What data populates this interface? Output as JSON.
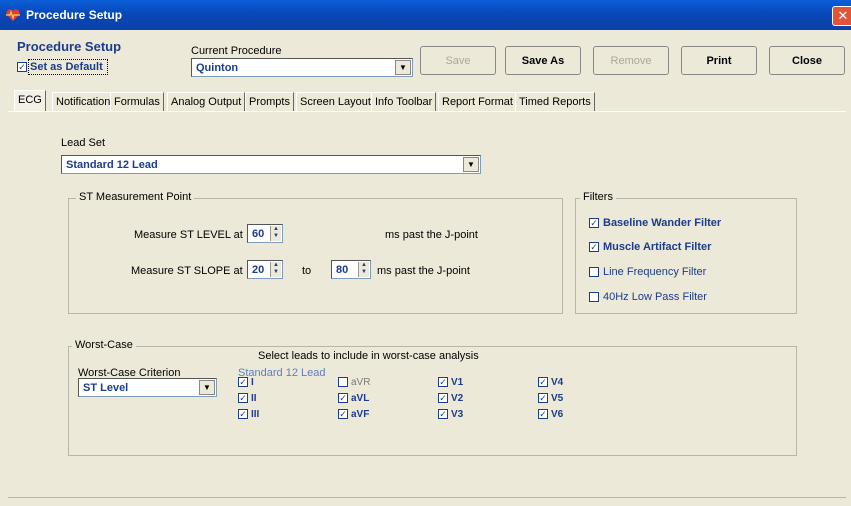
{
  "window": {
    "title": "Procedure Setup",
    "close_glyph": "✕"
  },
  "header": {
    "heading": "Procedure Setup",
    "set_as_default": {
      "label": "Set as Default",
      "checked": true
    },
    "current_procedure": {
      "label": "Current Procedure",
      "value": "Quinton"
    }
  },
  "toolbar": {
    "save": "Save",
    "save_as": "Save As",
    "remove": "Remove",
    "print": "Print",
    "close": "Close"
  },
  "tabs": [
    {
      "label": "ECG",
      "active": true
    },
    {
      "label": "Notification"
    },
    {
      "label": "Formulas"
    },
    {
      "label": "Analog Output"
    },
    {
      "label": "Prompts"
    },
    {
      "label": "Screen Layout"
    },
    {
      "label": "Info Toolbar"
    },
    {
      "label": "Report Format"
    },
    {
      "label": "Timed Reports"
    }
  ],
  "ecg": {
    "lead_set": {
      "label": "Lead Set",
      "value": "Standard 12 Lead"
    },
    "st_measurement": {
      "title": "ST Measurement Point",
      "level_label": "Measure ST LEVEL at",
      "level_value": "60",
      "level_units": "ms past the J-point",
      "slope_label": "Measure ST SLOPE at",
      "slope_from": "20",
      "slope_to_label": "to",
      "slope_to": "80",
      "slope_units": "ms past the J-point"
    },
    "filters": {
      "title": "Filters",
      "items": [
        {
          "label": "Baseline Wander Filter",
          "checked": true
        },
        {
          "label": "Muscle Artifact Filter",
          "checked": true
        },
        {
          "label": "Line Frequency Filter",
          "checked": false
        },
        {
          "label": "40Hz Low Pass Filter",
          "checked": false
        }
      ]
    },
    "worst_case": {
      "title": "Worst-Case",
      "heading": "Select leads to include in worst-case analysis",
      "criterion_label": "Worst-Case Criterion",
      "criterion_value": "ST Level",
      "lead_set_label": "Standard 12 Lead",
      "leads": [
        {
          "label": "I",
          "checked": true
        },
        {
          "label": "II",
          "checked": true
        },
        {
          "label": "III",
          "checked": true
        },
        {
          "label": "aVR",
          "checked": false
        },
        {
          "label": "aVL",
          "checked": true
        },
        {
          "label": "aVF",
          "checked": true
        },
        {
          "label": "V1",
          "checked": true
        },
        {
          "label": "V2",
          "checked": true
        },
        {
          "label": "V3",
          "checked": true
        },
        {
          "label": "V4",
          "checked": true
        },
        {
          "label": "V5",
          "checked": true
        },
        {
          "label": "V6",
          "checked": true
        }
      ]
    }
  }
}
